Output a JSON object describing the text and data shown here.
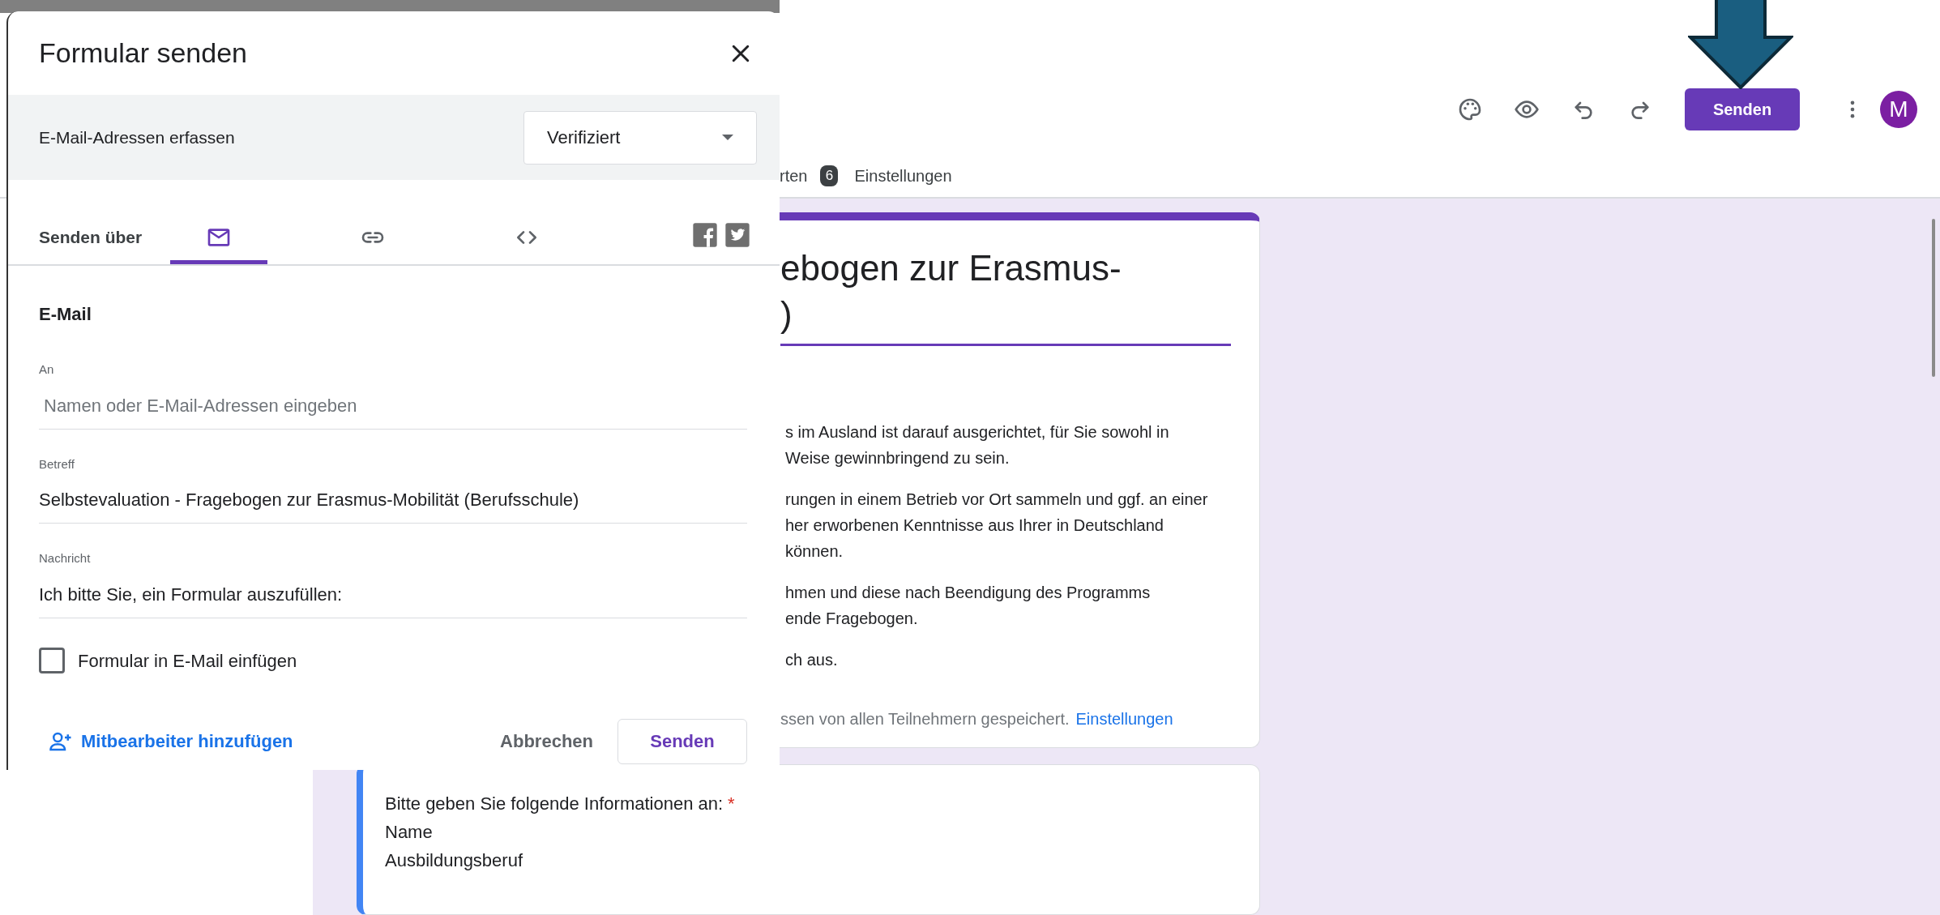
{
  "toolbar": {
    "send_button": "Senden",
    "avatar": "M"
  },
  "tabs": [
    {
      "label": "rten",
      "count": "6"
    },
    {
      "label": "Einstellungen"
    }
  ],
  "form": {
    "title_lines": [
      "ebogen zur Erasmus-",
      ")"
    ],
    "description": [
      [
        "s im Ausland ist darauf ausgerichtet, für Sie sowohl in",
        "Weise gewinnbringend zu sein."
      ],
      [
        "rungen in einem Betrieb vor Ort sammeln und ggf. an einer",
        "her erworbenen Kenntnisse aus Ihrer in Deutschland",
        "können."
      ],
      [
        "hmen und diese nach Beendigung des Programms",
        "ende Fragebogen."
      ],
      [
        "ch aus."
      ]
    ],
    "email_notice": {
      "text": "ssen von allen Teilnehmern gespeichert.",
      "link": "Einstellungen"
    }
  },
  "question": {
    "lines": [
      "Bitte geben Sie folgende Informationen an:",
      "Name",
      "Ausbildungsberuf"
    ],
    "required_mark": "*"
  },
  "dialog": {
    "title": "Formular senden",
    "collect_emails": {
      "label": "E-Mail-Adressen erfassen",
      "value": "Verifiziert"
    },
    "send_via": {
      "label": "Senden über",
      "tabs": [
        {
          "kind": "email",
          "selected": true
        },
        {
          "kind": "link",
          "selected": false
        },
        {
          "kind": "embed",
          "selected": false
        }
      ]
    },
    "section_title": "E-Mail",
    "fields": [
      {
        "label": "An",
        "placeholder": "Namen oder E-Mail-Adressen eingeben"
      },
      {
        "label": "Betreff",
        "value": "Selbstevaluation - Fragebogen zur Erasmus-Mobilität (Berufsschule)"
      },
      {
        "label": "Nachricht",
        "value": "Ich bitte Sie, ein Formular auszufüllen:"
      }
    ],
    "include_form": {
      "label": "Formular in E-Mail einfügen",
      "checked": false
    },
    "add_collaborators": "Mitbearbeiter hinzufügen",
    "buttons": [
      "Abbrechen",
      "Senden"
    ]
  }
}
